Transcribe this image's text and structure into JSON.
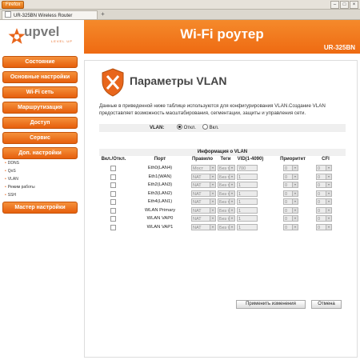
{
  "browser": {
    "firefox_label": "Firefox",
    "tab_title": "UR-325BN Wireless Router",
    "new_tab": "+",
    "win_controls": [
      "–",
      "□",
      "×"
    ]
  },
  "header": {
    "logo_text": "upvel",
    "logo_tagline": "LEVEL UP",
    "title": "Wi-Fi роутер",
    "model": "UR-325BN"
  },
  "sidebar": {
    "items": [
      {
        "label": "Состояние"
      },
      {
        "label": "Основные настройки"
      },
      {
        "label": "Wi-Fi сеть"
      },
      {
        "label": "Маршрутизация"
      },
      {
        "label": "Доступ"
      },
      {
        "label": "Сервис"
      },
      {
        "label": "Доп. настройки"
      }
    ],
    "subitems": [
      "DDNS",
      "QoS",
      "VLAN",
      "Режим работы",
      "SSH"
    ],
    "wizard": "Мастер настройки"
  },
  "main": {
    "heading": "Параметры VLAN",
    "description": "Данные в приведенной ниже таблице используются для конфигурирования VLAN.Создание VLAN предоставляет возможность масштабирования, сегментации, защиты и управления сети.",
    "vlan_label": "VLAN:",
    "vlan_off": "Откл.",
    "vlan_on": "Вкл.",
    "vlan_state": "off",
    "table": {
      "caption": "Информация о VLAN",
      "headers": [
        "Вкл./Откл.",
        "Порт",
        "Правило",
        "Теги",
        "VID(1-4090)",
        "Приоритет",
        "CFI"
      ],
      "rows": [
        {
          "port": "Eth0(LAN4)",
          "rule": "Мост",
          "tag": "Без тег",
          "vid": "700",
          "priority": "0",
          "cfi": "0"
        },
        {
          "port": "Eth1(WAN)",
          "rule": "NAT",
          "tag": "Без тег",
          "vid": "1",
          "priority": "0",
          "cfi": "0"
        },
        {
          "port": "Eth2(LAN3)",
          "rule": "NAT",
          "tag": "Без тег",
          "vid": "1",
          "priority": "0",
          "cfi": "0"
        },
        {
          "port": "Eth3(LAN2)",
          "rule": "NAT",
          "tag": "Без тег",
          "vid": "1",
          "priority": "0",
          "cfi": "0"
        },
        {
          "port": "Eth4(LAN1)",
          "rule": "NAT",
          "tag": "Без тег",
          "vid": "1",
          "priority": "0",
          "cfi": "0"
        },
        {
          "port": "WLAN Primary",
          "rule": "NAT",
          "tag": "Без тег",
          "vid": "1",
          "priority": "0",
          "cfi": "0"
        },
        {
          "port": "WLAN VAP0",
          "rule": "NAT",
          "tag": "Без тег",
          "vid": "1",
          "priority": "0",
          "cfi": "0"
        },
        {
          "port": "WLAN VAP1",
          "rule": "NAT",
          "tag": "Без тег",
          "vid": "1",
          "priority": "0",
          "cfi": "0"
        }
      ]
    },
    "apply_label": "Применить изменения",
    "cancel_label": "Отмена"
  },
  "colors": {
    "accent": "#ee6a12",
    "button_border": "#c45209"
  }
}
